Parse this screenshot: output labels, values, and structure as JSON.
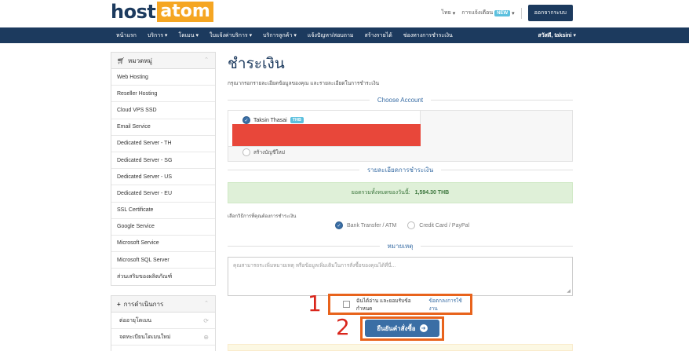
{
  "header": {
    "logo_host": "host",
    "logo_atom": "atom",
    "language": "ไทย",
    "notifications": "การแจ้งเตือน",
    "new_badge": "NEW",
    "logout": "ออกจากระบบ"
  },
  "nav": {
    "items": [
      "หน้าแรก",
      "บริการ",
      "โดเมน",
      "ใบแจ้งค่าบริการ",
      "บริการลูกค้า",
      "แจ้งปัญหา/สอบถาม",
      "สร้างรายได้",
      "ช่องทางการชำระเงิน"
    ],
    "dropdown": [
      false,
      true,
      true,
      true,
      true,
      false,
      false,
      false
    ],
    "user": "สวัสดี, taksini"
  },
  "sidebar": {
    "categories_title": "หมวดหมู่",
    "categories": [
      "Web Hosting",
      "Reseller Hosting",
      "Cloud VPS SSD",
      "Email Service",
      "Dedicated Server - TH",
      "Dedicated Server - SG",
      "Dedicated Server - US",
      "Dedicated Server - EU",
      "SSL Certificate",
      "Google Service",
      "Microsoft Service",
      "Microsoft SQL Server",
      "ส่วนเสริมของผลิตภัณฑ์"
    ],
    "actions_title": "การดำเนินการ",
    "actions": [
      {
        "label": "ต่ออายุโดเมน",
        "icon": "refresh-icon"
      },
      {
        "label": "จดทะเบียนโดเมนใหม่",
        "icon": "globe-icon"
      }
    ]
  },
  "main": {
    "title": "ชำระเงิน",
    "intro": "กรุณากรอกรายละเอียดข้อมูลของคุณ และรายละเอียดในการชำระเงิน",
    "choose_account": "Choose Account",
    "account_name": "Taksin Thasai",
    "account_tag": "THB",
    "new_account": "สร้างบัญชีใหม่",
    "payment_details": "รายละเอียดการชำระเงิน",
    "total_label": "ยอดรวมทั้งหมดของวันนี้:",
    "total_amount": "1,594.30 THB",
    "pay_method_label": "เลือกวิธีการที่คุณต้องการชำระเงิน",
    "pay_options": [
      "Bank Transfer / ATM",
      "Credit Card / PayPal"
    ],
    "pay_selected": 0,
    "notes_title": "หมายเหตุ",
    "notes_placeholder": "คุณสามารถระเพิ่มหมายเหตุ หรือข้อมูลเพิ่มเติมในการสั่งซื้อของคุณได้ที่นี่...",
    "agree_text": "ฉันได้อ่าน และยอมรับข้อกำหนด",
    "agree_link": "ข้อตกลงการใช้งาน",
    "order_button": "ยืนยันคำสั่งซื้อ",
    "annotation_1": "1",
    "annotation_2": "2"
  },
  "colors": {
    "navy": "#1c3a5e",
    "accent": "#3a6ea5",
    "orange": "#f5a623",
    "highlight": "#e8631c",
    "redact": "#e8473a"
  }
}
